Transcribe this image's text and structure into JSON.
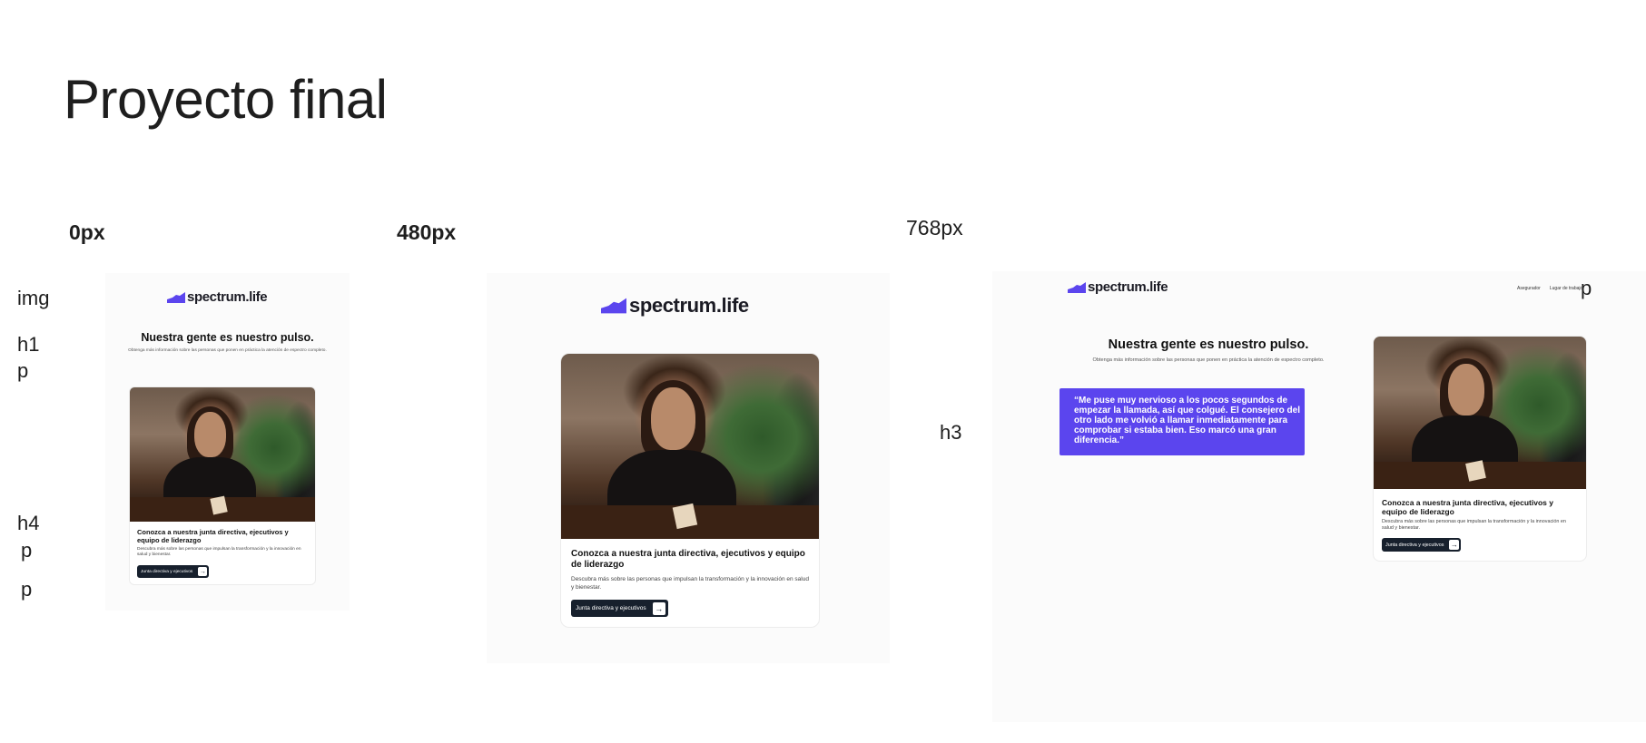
{
  "page": {
    "title": "Proyecto final"
  },
  "breakpoints": {
    "bp0": "0px",
    "bp480": "480px",
    "bp768": "768px"
  },
  "tags": {
    "img": "img",
    "h1": "h1",
    "p1": "p",
    "h4": "h4",
    "p2": "p",
    "p3": "p",
    "h3": "h3",
    "p_right": "p"
  },
  "site": {
    "logo_text": "spectrum.life",
    "heading": "Nuestra gente es nuestro pulso.",
    "subheading": "Obtenga más información sobre las personas que ponen en práctica la atención de espectro completo.",
    "card_title": "Conozca a nuestra junta directiva, ejecutivos y equipo de liderazgo",
    "card_description": "Descubra más sobre las personas que impulsan la transformación y la innovación en salud y bienestar.",
    "card_button": "Junta directiva y ejecutivos",
    "quote": "“Me puse muy nervioso a los pocos segundos de empezar la llamada, así que colgué. El consejero del otro lado me volvió a llamar inmediatamente para comprobar si estaba bien. Eso marcó una gran diferencia.”",
    "nav": [
      "Asegurador",
      "Lugar de trabajo"
    ]
  },
  "colors": {
    "brand": "#5b45ee",
    "button_dark": "#17202d",
    "text": "#1e1e1e"
  },
  "icons": {
    "logo_mark": "spectrum-logo-icon",
    "button_arrow": "arrow-right-icon"
  }
}
